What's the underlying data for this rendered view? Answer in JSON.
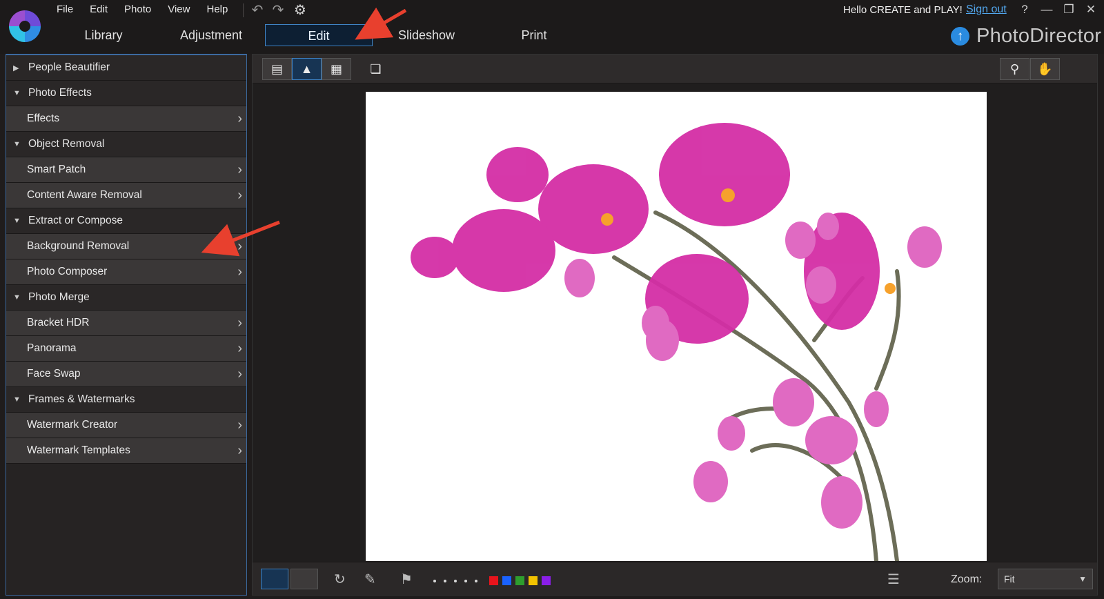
{
  "menu": [
    "File",
    "Edit",
    "Photo",
    "View",
    "Help"
  ],
  "toolbar_icons": [
    "undo-icon",
    "redo-icon",
    "settings-icon"
  ],
  "tabs": [
    {
      "label": "Library",
      "active": false
    },
    {
      "label": "Adjustment",
      "active": false
    },
    {
      "label": "Edit",
      "active": true
    },
    {
      "label": "Slideshow",
      "active": false
    },
    {
      "label": "Print",
      "active": false
    }
  ],
  "header": {
    "greeting": "Hello CREATE and PLAY!",
    "signout": "Sign out",
    "help": "?",
    "brand": "PhotoDirector"
  },
  "sidebar": [
    {
      "type": "section",
      "label": "People Beautifier",
      "expanded": false
    },
    {
      "type": "section",
      "label": "Photo Effects",
      "expanded": true
    },
    {
      "type": "item",
      "label": "Effects"
    },
    {
      "type": "section",
      "label": "Object Removal",
      "expanded": true
    },
    {
      "type": "item",
      "label": "Smart Patch"
    },
    {
      "type": "item",
      "label": "Content Aware Removal"
    },
    {
      "type": "section",
      "label": "Extract or Compose",
      "expanded": true
    },
    {
      "type": "item",
      "label": "Background Removal"
    },
    {
      "type": "item",
      "label": "Photo Composer"
    },
    {
      "type": "section",
      "label": "Photo Merge",
      "expanded": true
    },
    {
      "type": "item",
      "label": "Bracket HDR"
    },
    {
      "type": "item",
      "label": "Panorama"
    },
    {
      "type": "item",
      "label": "Face Swap"
    },
    {
      "type": "section",
      "label": "Frames & Watermarks",
      "expanded": true
    },
    {
      "type": "item",
      "label": "Watermark Creator"
    },
    {
      "type": "item",
      "label": "Watermark Templates"
    }
  ],
  "view_buttons": [
    "browser-view-icon",
    "single-view-icon",
    "grid-view-icon",
    "second-display-icon"
  ],
  "tools": [
    "zoom-tool-icon",
    "pan-hand-icon"
  ],
  "bottom_toolbar": {
    "rating_dots": 5,
    "color_labels": [
      "#e8141c",
      "#1a62ff",
      "#2e9e2e",
      "#f2c300",
      "#8a1ee8"
    ],
    "zoom_label": "Zoom:",
    "zoom_value": "Fit"
  },
  "accent_color": "#3f83c4"
}
